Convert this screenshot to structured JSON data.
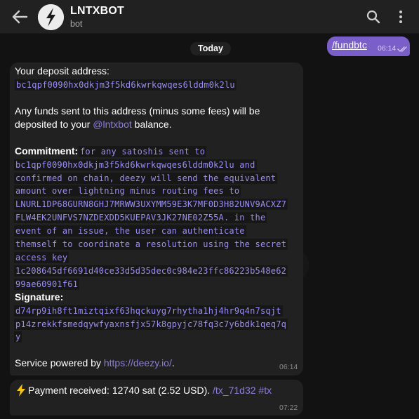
{
  "header": {
    "title": "LNTXBOT",
    "subtitle": "bot"
  },
  "date_chip": "Today",
  "outgoing": {
    "text": "/fundbtc",
    "time": "06:14"
  },
  "deposit_message": {
    "deposit_label": "Your deposit address:",
    "address": "bc1qpf0090hx0dkjm3f5kd6kwrkqwqes6lddm0k2lu",
    "funds_line1": "Any funds sent to this address (minus some fees) will be",
    "funds_line2_a": "deposited to your ",
    "funds_mention": "@lntxbot",
    "funds_line2_b": " balance.",
    "commitment_label": "Commitment:",
    "commitment_lines": [
      "for any satoshis sent to",
      "bc1qpf0090hx0dkjm3f5kd6kwrkqwqes6lddm0k2lu and",
      "confirmed on chain, deezy will send the equivalent",
      "amount over lightning minus routing fees to",
      "LNURL1DP68GURN8GHJ7MRWW3UXYMM59E3K7MF0D3H82UNV9ACXZ7",
      "FLW4EK2UNFVS7NZDEXDD5KUEPAV3JK27NE02Z55A. in the",
      "event of an issue, the user can authenticate",
      "themself to coordinate a resolution using the secret",
      "access key",
      "1c208645df6691d40ce33d5d35dec0c984e23ffc86223b548e62",
      "99ae60901f61"
    ],
    "signature_label": "Signature:",
    "signature_lines": [
      "d74rp9ih8ft1miztqixf63hqckuyg7rhytha1hj4hr9q4n7sqjt",
      "p14zrekkfsmedqywfyaxnsfjx57k8gpyjc78fq3c7y6bdk1qeq7q",
      "y"
    ],
    "service_text": "Service powered by ",
    "service_link": "https://deezy.io/",
    "service_end": ".",
    "time": "06:14"
  },
  "payment_message": {
    "icon": "lightning-icon",
    "text": " Payment received: 12740 sat (2.52 USD). ",
    "tx_link": "/tx_71d32",
    "tag_link": "#tx",
    "time": "07:22"
  },
  "colors": {
    "accent": "#7b5fc9",
    "link": "#8d7ee0",
    "bubble_in": "#212121",
    "header": "#212121"
  }
}
